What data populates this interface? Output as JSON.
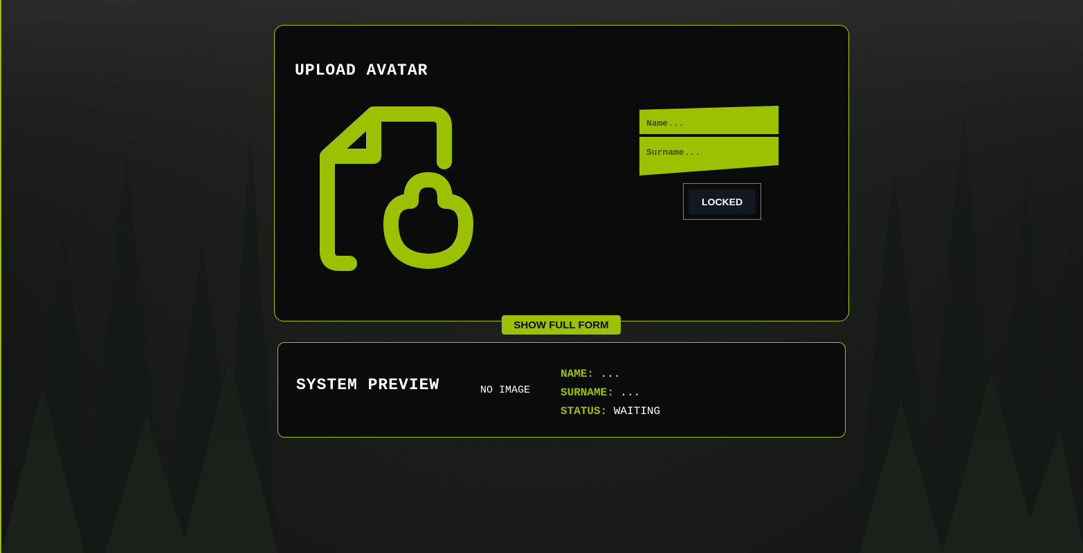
{
  "upload": {
    "title": "UPLOAD AVATAR",
    "icon": "file-upload-cloud-icon",
    "name_placeholder": "Name...",
    "surname_placeholder": "Surname...",
    "lock_label": "LOCKED"
  },
  "show_form_label": "SHOW FULL FORM",
  "preview": {
    "title": "SYSTEM PREVIEW",
    "no_image": "NO IMAGE",
    "name_key": "NAME:",
    "name_value": "...",
    "surname_key": "SURNAME:",
    "surname_value": "...",
    "status_key": "STATUS:",
    "status_value": "WAITING"
  },
  "colors": {
    "accent": "#9bc100",
    "panel": "#0b0b0b",
    "button_dark": "#111820"
  }
}
